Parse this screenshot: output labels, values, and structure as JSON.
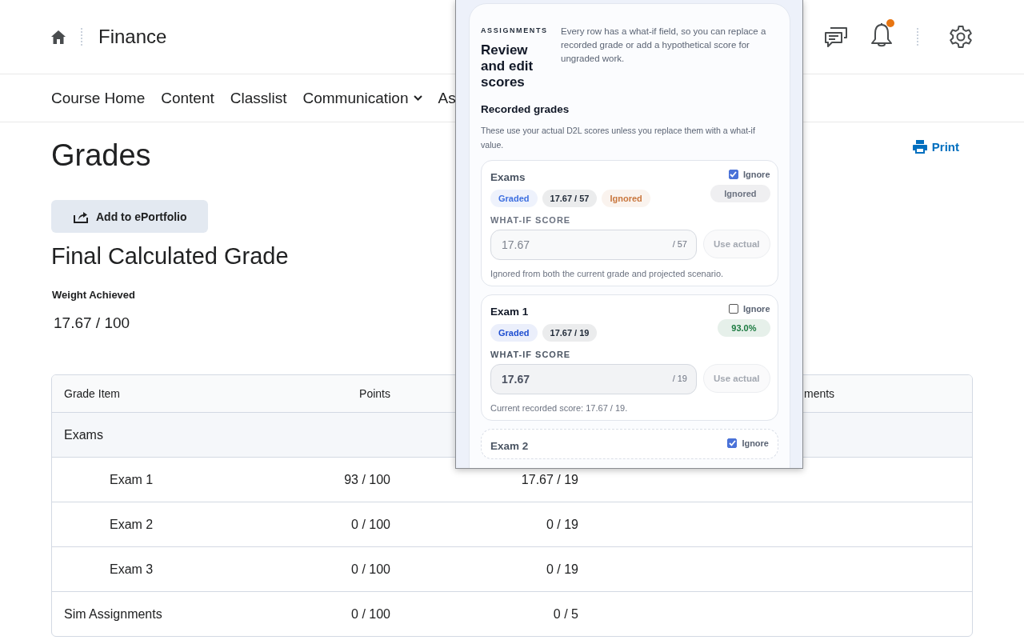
{
  "header": {
    "course_title": "Finance",
    "notifications_unread": true
  },
  "nav": {
    "items": [
      {
        "label": "Course Home",
        "dropdown": false
      },
      {
        "label": "Content",
        "dropdown": false
      },
      {
        "label": "Classlist",
        "dropdown": false
      },
      {
        "label": "Communication",
        "dropdown": true
      },
      {
        "label": "As",
        "dropdown": false
      }
    ]
  },
  "page": {
    "title": "Grades",
    "print_link": "Print",
    "portfolio_button": "Add to ePortfolio",
    "final_grade": {
      "heading": "Final Calculated Grade",
      "label": "Weight Achieved",
      "value": "17.67 / 100"
    }
  },
  "table": {
    "column_headers": {
      "grade_item": "Grade Item",
      "points": "Points",
      "column_4": "ments"
    },
    "rows": [
      {
        "kind": "group",
        "name": "Exams"
      },
      {
        "kind": "child",
        "name": "Exam 1",
        "points": "93 / 100",
        "column_3": "17.67 / 19"
      },
      {
        "kind": "child",
        "name": "Exam 2",
        "points": "0 / 100",
        "column_3": "0 / 19"
      },
      {
        "kind": "child",
        "name": "Exam 3",
        "points": "0 / 100",
        "column_3": "0 / 19"
      },
      {
        "kind": "single",
        "name": "Sim Assignments",
        "points": "0 / 100",
        "column_3": "0 / 5"
      }
    ]
  },
  "panel": {
    "eyebrow": "ASSIGNMENTS",
    "title": "Review and edit scores",
    "intro": "Every row has a what-if field, so you can replace a recorded grade or add a hypothetical score for ungraded work.",
    "section_title": "Recorded grades",
    "section_note": "These use your actual D2L scores unless you replace them with a what-if value.",
    "items": [
      {
        "name": "Exams",
        "ignore_label": "Ignore",
        "ignored": true,
        "pending": false,
        "badges": [
          {
            "text": "Graded",
            "color": "#3d6fe0"
          },
          {
            "text": "17.67 / 57",
            "color": "#1f2937"
          },
          {
            "text": "Ignored",
            "color": "#c9773e"
          }
        ],
        "status": {
          "text": "Ignored",
          "color": "#6b7280"
        },
        "field_label": "WHAT-IF SCORE",
        "value": "17.67",
        "suffix": "/ 57",
        "reset_button": "Use actual",
        "note": "Ignored from both the current grade and projected scenario."
      },
      {
        "name": "Exam 1",
        "ignore_label": "Ignore",
        "ignored": false,
        "pending": false,
        "badges": [
          {
            "text": "Graded",
            "color": "#1f4fd1"
          },
          {
            "text": "17.67 / 19",
            "color": "#1f2937"
          }
        ],
        "status": {
          "text": "93.0%",
          "color": "#1b7a40"
        },
        "field_label": "WHAT-IF SCORE",
        "value": "17.67",
        "suffix": "/ 19",
        "reset_button": "Use actual",
        "note": "Current recorded score: 17.67 / 19."
      },
      {
        "name": "Exam 2",
        "ignore_label": "Ignore",
        "ignored": true,
        "pending": true
      }
    ]
  }
}
